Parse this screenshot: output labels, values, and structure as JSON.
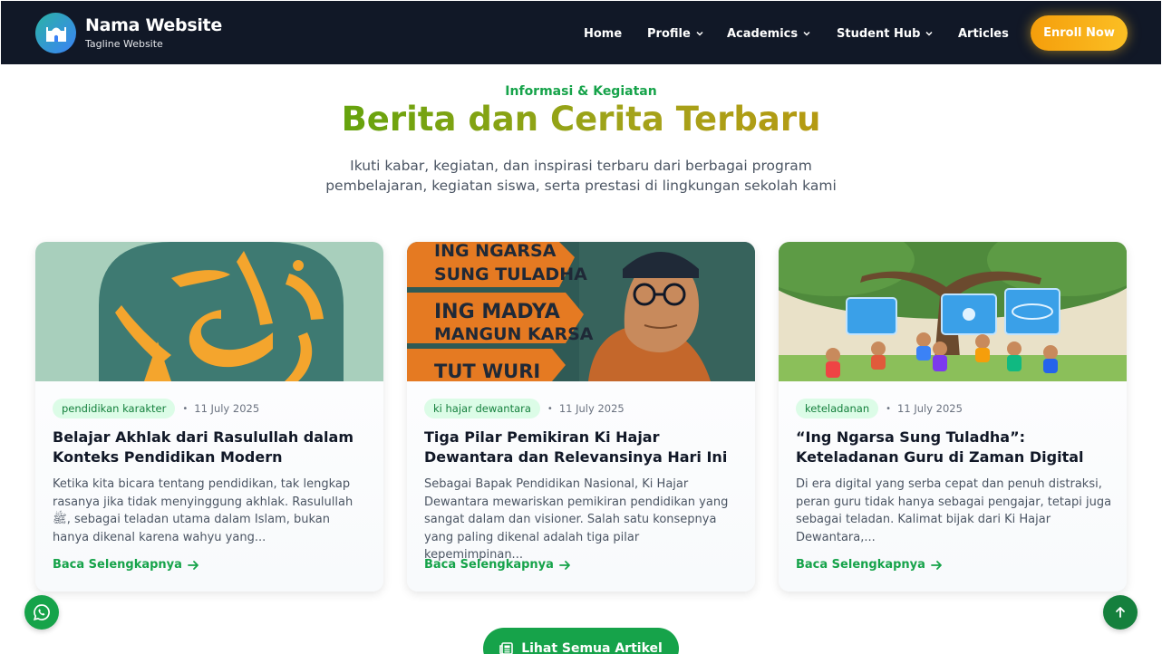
{
  "header": {
    "brand_name": "Nama Website",
    "tagline": "Tagline Website",
    "logo_icon": "mosque-icon",
    "nav": [
      {
        "label": "Home",
        "dropdown": false
      },
      {
        "label": "Profile",
        "dropdown": true
      },
      {
        "label": "Academics",
        "dropdown": true
      },
      {
        "label": "Student Hub",
        "dropdown": true
      },
      {
        "label": "Articles",
        "dropdown": false
      }
    ],
    "cta_label": "Enroll Now"
  },
  "section": {
    "eyebrow": "Informasi & Kegiatan",
    "title": "Berita dan Cerita Terbaru",
    "subtitle": "Ikuti kabar, kegiatan, dan inspirasi terbaru dari berbagai program pembelajaran, kegiatan siswa, serta prestasi di lingkungan sekolah kami"
  },
  "articles": [
    {
      "tag": "pendidikan karakter",
      "date": "11 July 2025",
      "title": "Belajar Akhlak dari Rasulullah dalam Konteks Pendidikan Modern",
      "excerpt": "Ketika kita bicara tentang pendidikan, tak lengkap rasanya jika tidak menyinggung akhlak. Rasulullah ﷺ, sebagai teladan utama dalam Islam, bukan hanya dikenal karena wahyu yang...",
      "read_more": "Baca Selengkapnya",
      "image_caption": ""
    },
    {
      "tag": "ki hajar dewantara",
      "date": "11 July 2025",
      "title": "Tiga Pilar Pemikiran Ki Hajar Dewantara dan Relevansinya Hari Ini",
      "excerpt": "Sebagai Bapak Pendidikan Nasional, Ki Hajar Dewantara mewariskan pemikiran pendidikan yang sangat dalam dan visioner. Salah satu konsepnya yang paling dikenal adalah tiga pilar kepemimpinan...",
      "read_more": "Baca Selengkapnya",
      "image_text": [
        "ING NGARSA",
        "SUNG TULADHA",
        "ING MADYA",
        "MANGUN KARSA",
        "TUT WURI"
      ]
    },
    {
      "tag": "keteladanan",
      "date": "11 July 2025",
      "title": "“Ing Ngarsa Sung Tuladha”: Keteladanan Guru di Zaman Digital",
      "excerpt": "Di era digital yang serba cepat dan penuh distraksi, peran guru tidak hanya sebagai pengajar, tetapi juga sebagai teladan. Kalimat bijak dari Ki Hajar Dewantara,...",
      "read_more": "Baca Selengkapnya"
    }
  ],
  "all_articles_label": "Lihat Semua Artikel",
  "floating": {
    "whatsapp_icon": "whatsapp-icon",
    "top_icon": "arrow-up-icon"
  },
  "colors": {
    "navbar": "#111827",
    "accent_green": "#16a34a",
    "cta_orange": "#f59e0b"
  }
}
